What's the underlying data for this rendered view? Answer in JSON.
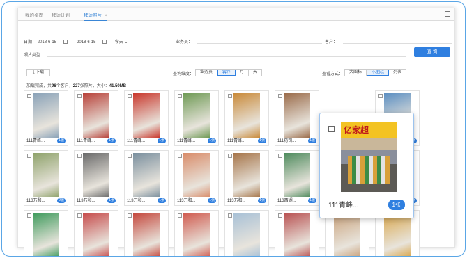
{
  "tabs": [
    {
      "label": "我的桌面"
    },
    {
      "label": "拜访计划"
    },
    {
      "label": "拜访照片",
      "close": "×"
    }
  ],
  "filters": {
    "date_label": "日期：",
    "date_start": "2018-6-15",
    "date_sep": "-",
    "date_end": "2018-6-15",
    "period": "今天",
    "salesman_label": "业务员：",
    "customer_label": "客户：",
    "photo_type_label": "照片类型：",
    "query_button": "查 询"
  },
  "toolbar": {
    "download": "下载",
    "dimension_label": "查询维度：",
    "dimension_options": [
      "业务员",
      "客户",
      "月",
      "天"
    ],
    "dimension_selected": "客户",
    "view_label": "查看方式：",
    "view_options": [
      "大图标",
      "小图标",
      "列表"
    ],
    "view_selected": "小图标"
  },
  "summary": {
    "prefix": "加载完成，共",
    "customers": "96",
    "mid": "个客户，",
    "photos": "227",
    "mid2": "张照片，大小：",
    "size": "41.50MB"
  },
  "rows": [
    {
      "cards": [
        {
          "name": "111青峰...",
          "count": "1张",
          "color": "#8aa2b8"
        },
        {
          "name": "111青峰...",
          "count": "1张",
          "color": "#b8423a"
        },
        {
          "name": "111青峰...",
          "count": "1张",
          "color": "#c9382d"
        },
        {
          "name": "111青峰...",
          "count": "1张",
          "color": "#6f9a55"
        },
        {
          "name": "111青峰...",
          "count": "1张",
          "color": "#c98a3a"
        },
        {
          "name": "111药司...",
          "count": "1张",
          "color": "#9a6b4a"
        },
        {
          "name": "",
          "count": "",
          "color": ""
        },
        {
          "name": "",
          "count": "1张",
          "color": "#5c8fc2"
        }
      ]
    },
    {
      "cards": [
        {
          "name": "113万和...",
          "count": "2张",
          "color": "#8ea26a"
        },
        {
          "name": "113万和...",
          "count": "1张",
          "color": "#6a6a6a"
        },
        {
          "name": "113万和...",
          "count": "1张",
          "color": "#7a8f9e"
        },
        {
          "name": "113万和...",
          "count": "1张",
          "color": "#d98c6a"
        },
        {
          "name": "113万和...",
          "count": "1张",
          "color": "#a6754a"
        },
        {
          "name": "113西湖...",
          "count": "1张",
          "color": "#4d8a5c"
        },
        {
          "name": "",
          "count": "",
          "color": ""
        },
        {
          "name": "",
          "count": "2张",
          "color": "#5aa0c8"
        }
      ]
    },
    {
      "cards": [
        {
          "name": "",
          "count": "",
          "color": "#3d9a5b"
        },
        {
          "name": "",
          "count": "",
          "color": "#c64a4a"
        },
        {
          "name": "",
          "count": "",
          "color": "#c4473c"
        },
        {
          "name": "",
          "count": "",
          "color": "#d05a4e"
        },
        {
          "name": "",
          "count": "",
          "color": "#a7c0d6"
        },
        {
          "name": "",
          "count": "",
          "color": "#b85050"
        },
        {
          "name": "",
          "count": "",
          "color": "#c9a17a"
        },
        {
          "name": "",
          "count": "",
          "color": "#d9a64a"
        }
      ]
    }
  ],
  "zoom_card": {
    "sign_text": "亿家超",
    "name": "111青峰...",
    "count": "1张"
  }
}
